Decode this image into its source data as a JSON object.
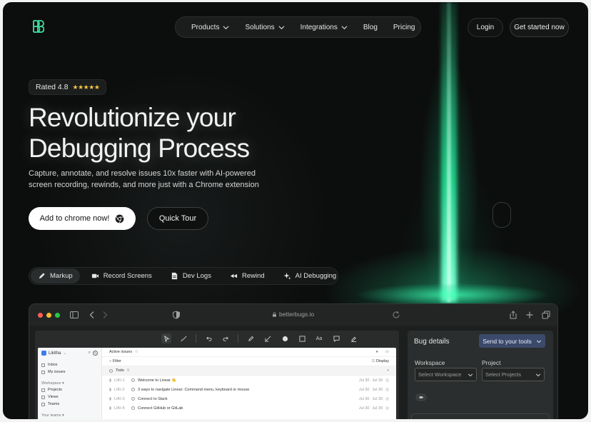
{
  "nav": {
    "items": [
      {
        "label": "Products",
        "has_dropdown": true
      },
      {
        "label": "Solutions",
        "has_dropdown": true
      },
      {
        "label": "Integrations",
        "has_dropdown": true
      },
      {
        "label": "Blog",
        "has_dropdown": false
      },
      {
        "label": "Pricing",
        "has_dropdown": false
      }
    ],
    "login": "Login",
    "get_started": "Get started now"
  },
  "hero": {
    "rating": "Rated 4.8",
    "stars": "★★★★★",
    "rating_value": 4.8,
    "headline_line1": "Revolutionize your",
    "headline_line2": "Debugging Process",
    "sub_line1": "Capture, annotate, and resolve issues 10x faster with AI-powered",
    "sub_line2": "screen recording, rewinds, and more just with a Chrome extension",
    "cta_primary": "Add to chrome now!",
    "cta_secondary": "Quick Tour"
  },
  "features": [
    {
      "label": "Markup",
      "icon": "pen-icon",
      "active": true
    },
    {
      "label": "Record Screens",
      "icon": "camera-icon",
      "active": false
    },
    {
      "label": "Dev Logs",
      "icon": "log-file-icon",
      "active": false
    },
    {
      "label": "Rewind",
      "icon": "rewind-icon",
      "active": false
    },
    {
      "label": "AI Debugging",
      "icon": "sparkle-icon",
      "active": false
    }
  ],
  "browser": {
    "url": "betterbugs.io",
    "dots": [
      "#ff5f57",
      "#febc2e",
      "#28c840"
    ]
  },
  "mock_app": {
    "workspace": "Likitha",
    "sidebar": [
      "Inbox",
      "My issues"
    ],
    "workspace_section": "Workspace",
    "workspace_items": [
      "Projects",
      "Views",
      "Teams"
    ],
    "teams_section": "Your teams",
    "header": "Active issues",
    "filter": "Filter",
    "display": "Display",
    "group": "Todo",
    "group_count": "9",
    "issues": [
      {
        "id": "LIKI-1",
        "title": "Welcome to Linear 👋",
        "date1": "Jul 30",
        "date2": "Jul 30"
      },
      {
        "id": "LIKI-2",
        "title": "3 ways to navigate Linear: Command menu, keyboard or mouse",
        "date1": "Jul 30",
        "date2": "Jul 30"
      },
      {
        "id": "LIKI-3",
        "title": "Connect to Slack",
        "date1": "Jul 30",
        "date2": "Jul 30"
      },
      {
        "id": "LIKI-4",
        "title": "Connect GitHub or GitLab",
        "date1": "Jul 30",
        "date2": "Jul 30"
      }
    ]
  },
  "bug_panel": {
    "title": "Bug details",
    "send": "Send to your tools",
    "workspace_label": "Workspace",
    "workspace_placeholder": "Select Workspace",
    "project_label": "Project",
    "project_placeholder": "Select Projects"
  },
  "colors": {
    "accent_glow": "#2dffb0",
    "background": "#0c0d0d",
    "send_button": "#3b4a6b",
    "stars": "#f5c542"
  }
}
